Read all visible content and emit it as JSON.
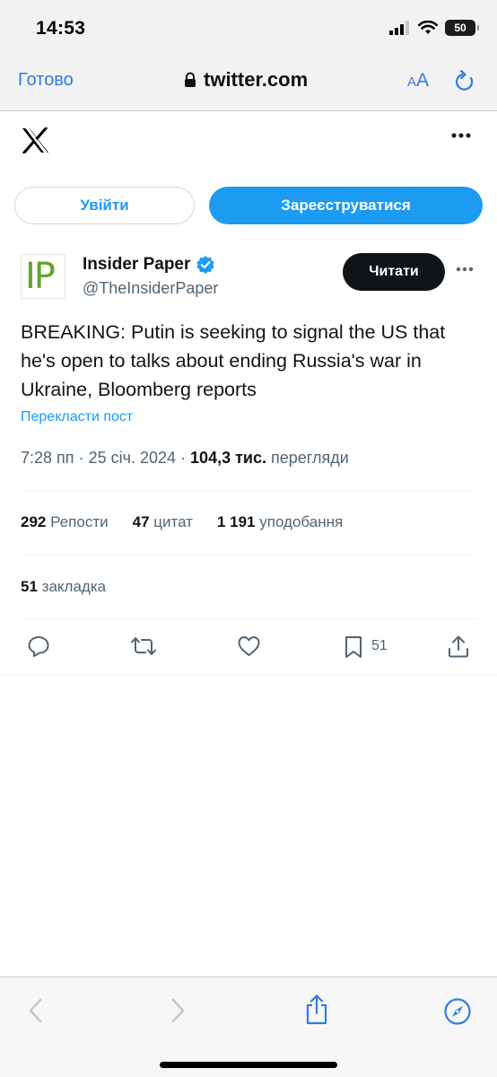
{
  "status_bar": {
    "time": "14:53",
    "battery": "50"
  },
  "browser": {
    "done_label": "Готово",
    "url": "twitter.com",
    "aa_label_small": "A",
    "aa_label_large": "A"
  },
  "auth": {
    "login_label": "Увійти",
    "signup_label": "Зареєструватися"
  },
  "author": {
    "avatar_text": "IP",
    "name": "Insider Paper",
    "handle": "@TheInsiderPaper",
    "read_label": "Читати"
  },
  "tweet": {
    "text": "BREAKING: Putin is seeking to signal the US that he's open to talks about ending Russia's war in Ukraine, Bloomberg reports",
    "translate_label": "Перекласти пост",
    "time": "7:28 пп",
    "date": "25 січ. 2024",
    "views_count": "104,3 тис.",
    "views_label": "перегляди",
    "separator": "·"
  },
  "stats": {
    "reposts_count": "292",
    "reposts_label": "Репости",
    "quotes_count": "47",
    "quotes_label": "цитат",
    "likes_count": "1 191",
    "likes_label": "уподобання",
    "bookmarks_count": "51",
    "bookmarks_label": "закладка"
  },
  "actions": {
    "bookmark_count": "51"
  },
  "colors": {
    "accent": "#1d9bf0",
    "ios_blue": "#2f7de1",
    "text": "#0f1419",
    "muted": "#536471"
  }
}
